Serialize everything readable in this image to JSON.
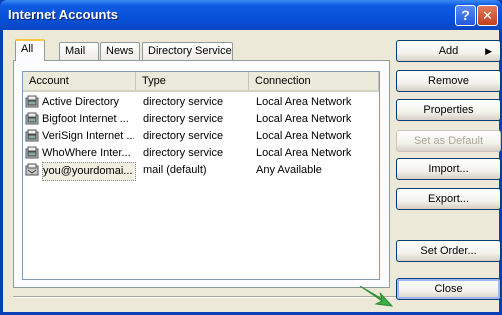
{
  "window": {
    "title": "Internet Accounts",
    "help_glyph": "?",
    "close_glyph": "✕"
  },
  "tabs": [
    "All",
    "Mail",
    "News",
    "Directory Service"
  ],
  "columns": [
    "Account",
    "Type",
    "Connection"
  ],
  "rows": [
    {
      "account": "Active Directory",
      "type": "directory service",
      "connection": "Local Area Network",
      "icon": "directory-service-icon"
    },
    {
      "account": "Bigfoot Internet ...",
      "type": "directory service",
      "connection": "Local Area Network",
      "icon": "directory-service-icon"
    },
    {
      "account": "VeriSign Internet ...",
      "type": "directory service",
      "connection": "Local Area Network",
      "icon": "directory-service-icon"
    },
    {
      "account": "WhoWhere Inter...",
      "type": "directory service",
      "connection": "Local Area Network",
      "icon": "directory-service-icon"
    },
    {
      "account": "you@yourdomai...",
      "type": "mail (default)",
      "connection": "Any Available",
      "icon": "mail-account-icon",
      "selected": true
    }
  ],
  "buttons": {
    "add": "Add",
    "remove": "Remove",
    "properties": "Properties",
    "set_default": "Set as Default",
    "import": "Import...",
    "export": "Export...",
    "set_order": "Set Order...",
    "close": "Close"
  },
  "colors": {
    "accent_pointer": "#3CB043",
    "title_bar": "#0A58E0"
  }
}
